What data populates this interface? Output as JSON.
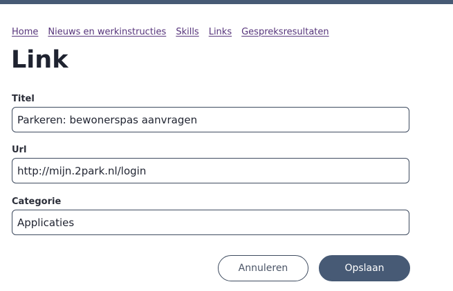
{
  "breadcrumb": {
    "items": [
      {
        "label": "Home"
      },
      {
        "label": "Nieuws en werkinstructies"
      },
      {
        "label": "Skills"
      },
      {
        "label": "Links"
      },
      {
        "label": "Gespreksresultaten"
      }
    ]
  },
  "page": {
    "title": "Link"
  },
  "form": {
    "titel": {
      "label": "Titel",
      "value": "Parkeren: bewonerspas aanvragen"
    },
    "url": {
      "label": "Url",
      "value": "http://mijn.2park.nl/login"
    },
    "categorie": {
      "label": "Categorie",
      "value": "Applicaties"
    }
  },
  "actions": {
    "cancel_label": "Annuleren",
    "save_label": "Opslaan"
  },
  "colors": {
    "topbar": "#475a75",
    "link": "#55337a",
    "primary_button": "#475a75",
    "border": "#3d4a5e"
  }
}
